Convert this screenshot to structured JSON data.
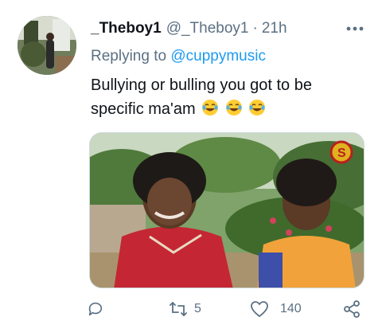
{
  "tweet": {
    "display_name": "_Theboy1",
    "handle": "@_Theboy1",
    "separator": "·",
    "time": "21h",
    "replying_prefix": "Replying to",
    "replying_handle": "@cuppymusic",
    "text_line1": "Bullying or bulling you got to be",
    "text_line2": "specific ma'am",
    "emoji": "face-with-tears-of-joy",
    "media_watermark": "S"
  },
  "actions": {
    "reply_count": "",
    "retweet_count": "5",
    "like_count": "140",
    "share_label": ""
  },
  "colors": {
    "text": "#0f1419",
    "secondary": "#5b7083",
    "link": "#1d9bf0",
    "border": "#cfd9de"
  },
  "icons": [
    "more-icon",
    "reply-icon",
    "retweet-icon",
    "like-icon",
    "share-icon"
  ]
}
